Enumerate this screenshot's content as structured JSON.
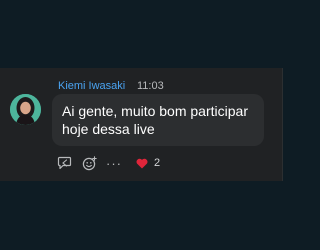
{
  "message": {
    "sender": "Kiemi Iwasaki",
    "time": "11:03",
    "text": "Ai gente, muito bom participar hoje dessa live",
    "avatar_icon": "profile-photo-avatar"
  },
  "actions": {
    "reply_icon": "reply-icon",
    "emoji_icon": "add-reaction-icon",
    "more_label": "···",
    "reaction_emoji": "❤️",
    "reaction_count": "2"
  },
  "colors": {
    "background": "#0e1c24",
    "panel": "#202224",
    "bubble": "#2c2e30",
    "sender": "#4aa3f0",
    "heart": "#e0253a"
  }
}
